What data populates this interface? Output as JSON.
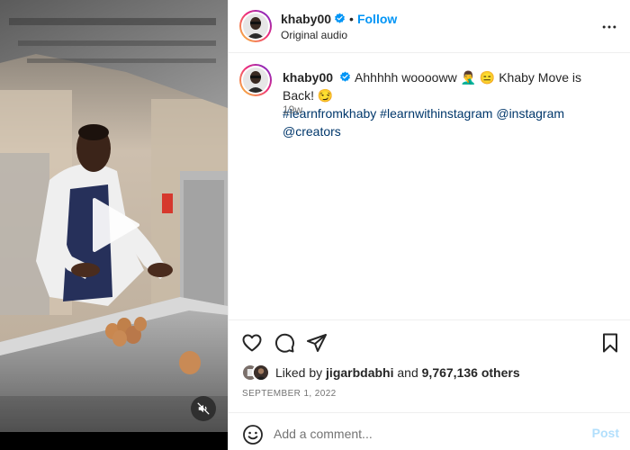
{
  "media": {
    "play_icon": "play-icon",
    "mute_icon": "speaker-muted-icon"
  },
  "header": {
    "username": "khaby00",
    "separator": "•",
    "follow_label": "Follow",
    "audio_label": "Original audio",
    "more_icon": "more-horizontal-icon"
  },
  "caption": {
    "username": "khaby00",
    "text_part1": "Ahhhhh wooooww 🤦‍♂️ 😑 Khaby Move is Back! 😏",
    "hashtags": [
      "#learnfromkhaby",
      "#learnwithinstagram",
      "@instagram",
      "@creators"
    ],
    "time_ago": "19w"
  },
  "actions": {
    "like_icon": "heart-icon",
    "comment_icon": "comment-icon",
    "share_icon": "paper-plane-icon",
    "save_icon": "bookmark-icon"
  },
  "likes": {
    "prefix": "Liked by",
    "user": "jigarbdabhi",
    "middle": "and",
    "count": "9,767,136 others"
  },
  "post_date": "SEPTEMBER 1, 2022",
  "comment": {
    "placeholder": "Add a comment...",
    "post_label": "Post",
    "emoji_icon": "smiley-icon"
  },
  "colors": {
    "accent": "#0095f6",
    "hashtag": "#00376b",
    "post_disabled": "#b2dffc",
    "muted": "#737373"
  }
}
